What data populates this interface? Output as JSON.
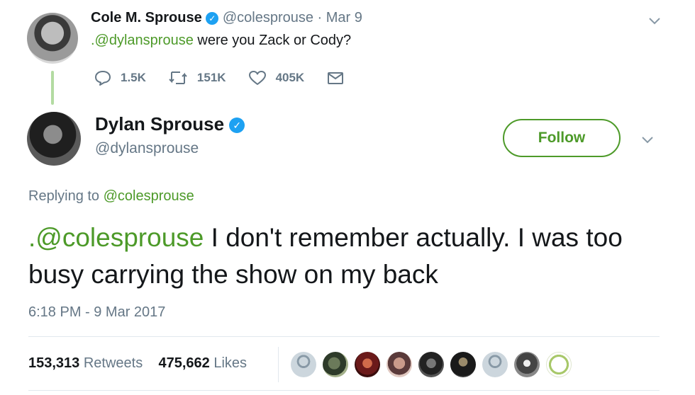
{
  "parent_tweet": {
    "author_name": "Cole M. Sprouse",
    "handle": "@colesprouse",
    "date": "Mar 9",
    "text_mention": ".@dylansprouse",
    "text_body": " were you Zack or Cody?",
    "actions": {
      "replies": "1.5K",
      "retweets": "151K",
      "likes": "405K"
    }
  },
  "main_tweet": {
    "author_name": "Dylan Sprouse",
    "handle": "@dylansprouse",
    "follow_label": "Follow",
    "replying_prefix": "Replying to ",
    "replying_to": "@colesprouse",
    "text_mention": ".@colesprouse",
    "text_body": " I don't remember actually. I was too busy carrying the show on my back",
    "timestamp": "6:18 PM - 9 Mar 2017",
    "retweet_count": "153,313",
    "retweet_label": "Retweets",
    "like_count": "475,662",
    "like_label": "Likes"
  },
  "colors": {
    "accent": "#4d9a29",
    "muted": "#657786",
    "verified": "#1da1f2"
  },
  "likers": [
    "default-avatar",
    "photo-avatar",
    "photo-avatar",
    "photo-avatar",
    "photo-avatar",
    "photo-avatar",
    "default-avatar",
    "photo-avatar",
    "wreath-avatar"
  ]
}
